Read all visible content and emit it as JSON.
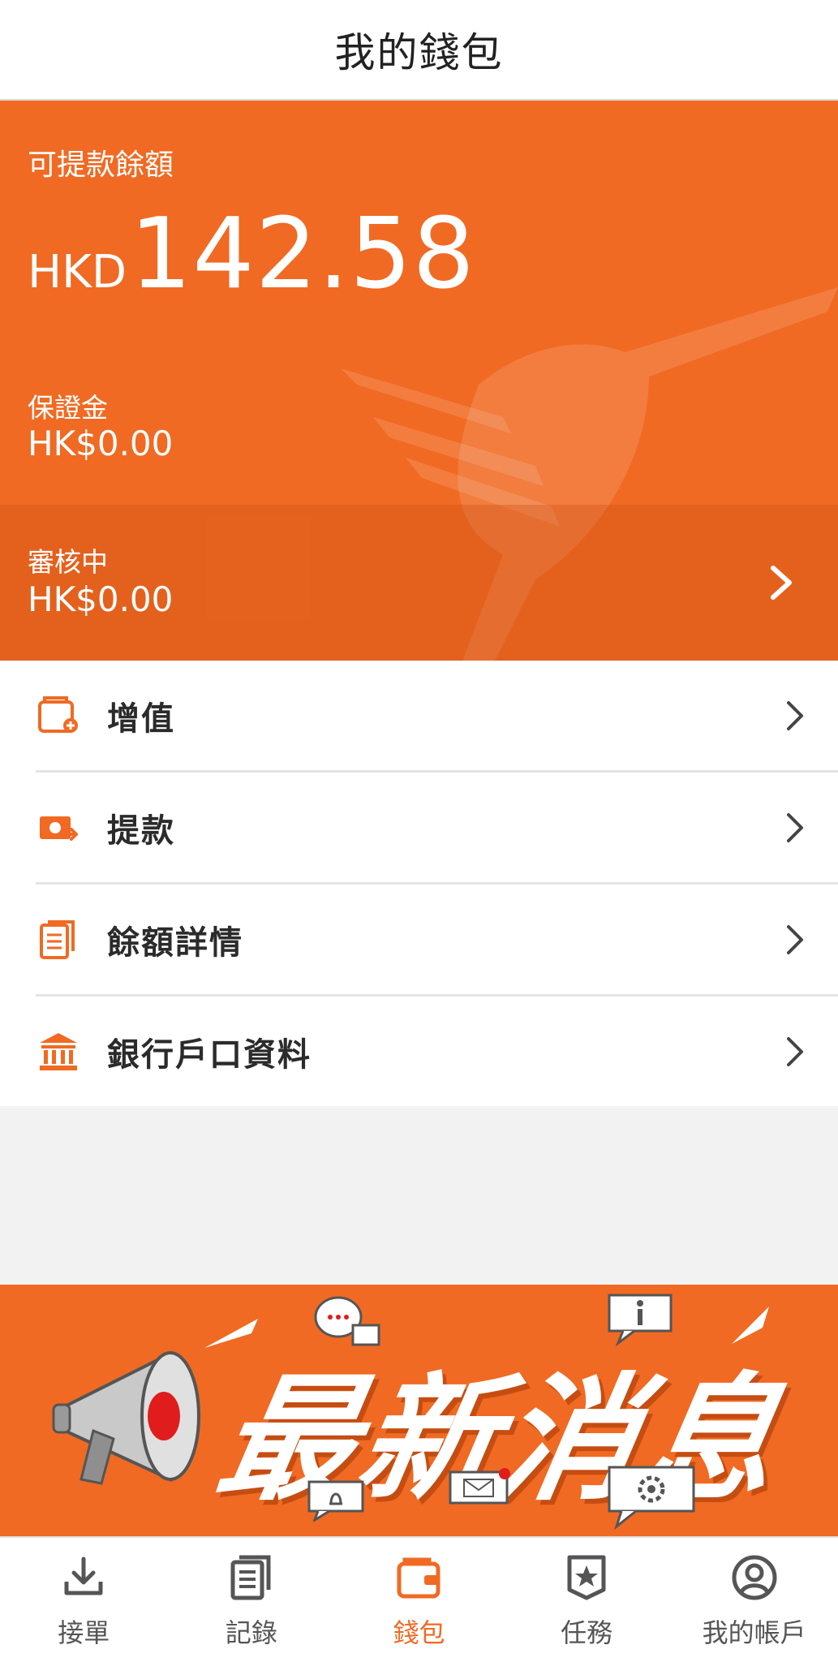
{
  "header": {
    "title": "我的錢包"
  },
  "balance": {
    "withdrawable_label": "可提款餘額",
    "currency": "HKD",
    "amount": "142.58",
    "deposit_label": "保證金",
    "deposit_value": "HK$0.00",
    "review_label": "審核中",
    "review_value": "HK$0.00"
  },
  "menu": {
    "items": [
      {
        "label": "增值",
        "icon": "wallet-add-icon"
      },
      {
        "label": "提款",
        "icon": "cash-withdraw-icon"
      },
      {
        "label": "餘額詳情",
        "icon": "document-list-icon"
      },
      {
        "label": "銀行戶口資料",
        "icon": "bank-icon"
      }
    ]
  },
  "banner": {
    "text": "最新消息"
  },
  "tabbar": {
    "tabs": [
      {
        "label": "接單",
        "icon": "download-icon"
      },
      {
        "label": "記錄",
        "icon": "records-icon"
      },
      {
        "label": "錢包",
        "icon": "wallet-icon",
        "active": true
      },
      {
        "label": "任務",
        "icon": "star-badge-icon"
      },
      {
        "label": "我的帳戶",
        "icon": "user-icon"
      }
    ]
  },
  "colors": {
    "accent": "#f06a23",
    "text": "#2b2b2b",
    "background": "#f2f2f3"
  }
}
